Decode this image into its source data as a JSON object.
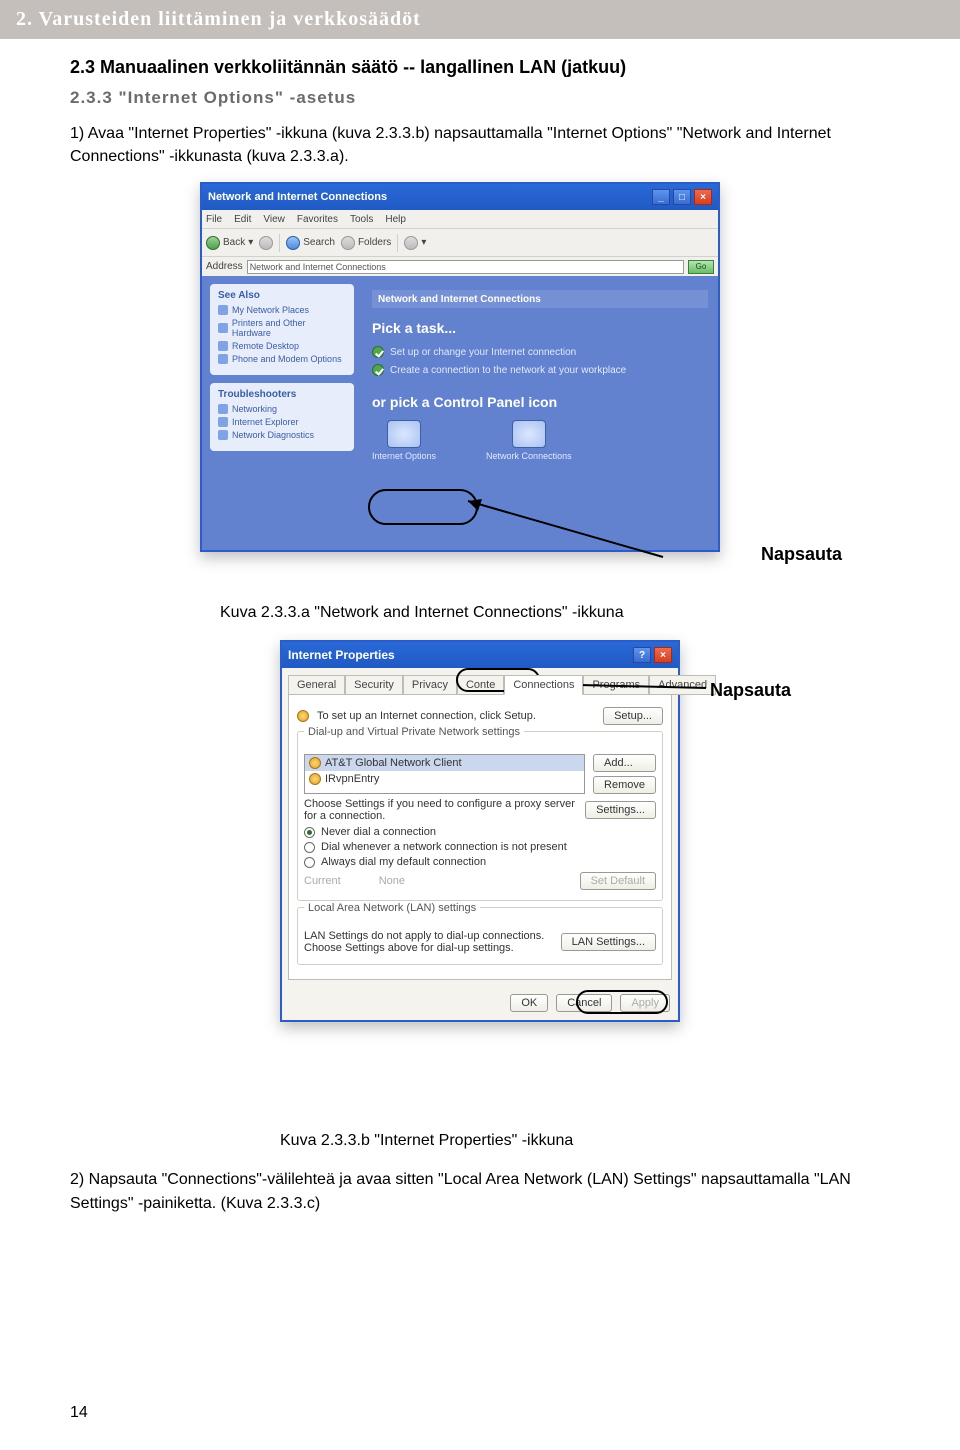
{
  "header": "2. Varusteiden liittäminen ja verkkosäädöt",
  "sub1": "2.3 Manuaalinen verkkoliitännän säätö -- langallinen LAN (jatkuu)",
  "sub2": "2.3.3 \"Internet Options\" -asetus",
  "para1": "1) Avaa \"Internet Properties\" -ikkuna (kuva 2.3.3.b) napsauttamalla \"Internet Options\" \"Network and Internet Connections\" -ikkunasta (kuva 2.3.3.a).",
  "napsauta": "Napsauta",
  "caption1": "Kuva 2.3.3.a \"Network and Internet Connections\" -ikkuna",
  "caption2": "Kuva 2.3.3.b \"Internet Properties\" -ikkuna",
  "para2": "2) Napsauta \"Connections\"-välilehteä ja avaa sitten \"Local Area Network (LAN) Settings\" napsauttamalla \"LAN Settings\" -painiketta. (Kuva 2.3.3.c)",
  "xp": {
    "title": "Network and Internet Connections",
    "menus": [
      "File",
      "Edit",
      "View",
      "Favorites",
      "Tools",
      "Help"
    ],
    "tb": {
      "back": "Back",
      "search": "Search",
      "folders": "Folders"
    },
    "addrLabel": "Address",
    "addrText": "Network and Internet Connections",
    "go": "Go",
    "seeAlso": "See Also",
    "side1": [
      "My Network Places",
      "Printers and Other Hardware",
      "Remote Desktop",
      "Phone and Modem Options"
    ],
    "trouble": "Troubleshooters",
    "side2": [
      "Networking",
      "Internet Explorer",
      "Network Diagnostics"
    ],
    "mainHdr": "Network and Internet Connections",
    "pick": "Pick a task...",
    "t1": "Set up or change your Internet connection",
    "t2": "Create a connection to the network at your workplace",
    "cpTitle": "or pick a Control Panel icon",
    "cp1": "Internet Options",
    "cp2": "Network Connections"
  },
  "dlg": {
    "title": "Internet Properties",
    "tabs": [
      "General",
      "Security",
      "Privacy",
      "Conte",
      "Connections",
      "Programs",
      "Advanced"
    ],
    "setupText": "To set up an Internet connection, click Setup.",
    "setup": "Setup...",
    "grp1": "Dial-up and Virtual Private Network settings",
    "list": [
      "AT&T Global Network Client",
      "IRvpnEntry"
    ],
    "add": "Add...",
    "remove": "Remove",
    "settings": "Settings...",
    "prox": "Choose Settings if you need to configure a proxy server for a connection.",
    "r1": "Never dial a connection",
    "r2": "Dial whenever a network connection is not present",
    "r3": "Always dial my default connection",
    "cur": "Current",
    "none": "None",
    "setdef": "Set Default",
    "grp2": "Local Area Network (LAN) settings",
    "lanText": "LAN Settings do not apply to dial-up connections. Choose Settings above for dial-up settings.",
    "lanBtn": "LAN Settings...",
    "ok": "OK",
    "cancel": "Cancel",
    "apply": "Apply"
  },
  "pagenum": "14"
}
